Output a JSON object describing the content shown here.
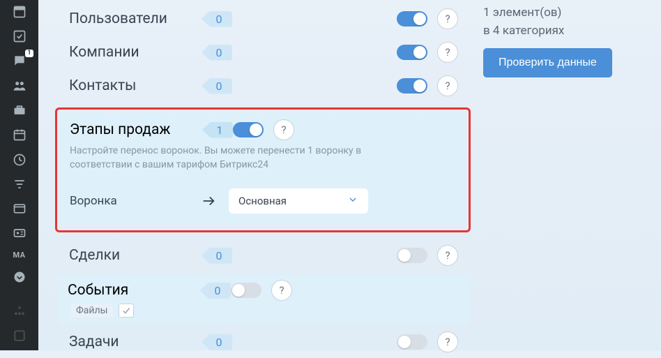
{
  "rail": {
    "chat_badge": "1",
    "ma_label": "MA"
  },
  "rows": {
    "users": {
      "label": "Пользователи",
      "count": "0"
    },
    "companies": {
      "label": "Компании",
      "count": "0"
    },
    "contacts": {
      "label": "Контакты",
      "count": "0"
    },
    "deals": {
      "label": "Сделки",
      "count": "0"
    },
    "events": {
      "label": "События",
      "count": "0",
      "files_label": "Файлы"
    },
    "tasks": {
      "label": "Задачи",
      "count": "0"
    }
  },
  "stages": {
    "label": "Этапы продаж",
    "count": "1",
    "desc": "Настройте перенос воронок. Вы можете перенести 1 воронку в соответствии с вашим тарифом Битрикс24",
    "funnel_label": "Воронка",
    "select_value": "Основная"
  },
  "side": {
    "elements_line": "1 элемент(ов)",
    "categories_line": "в 4 категориях",
    "check_button": "Проверить данные"
  },
  "help": "?"
}
